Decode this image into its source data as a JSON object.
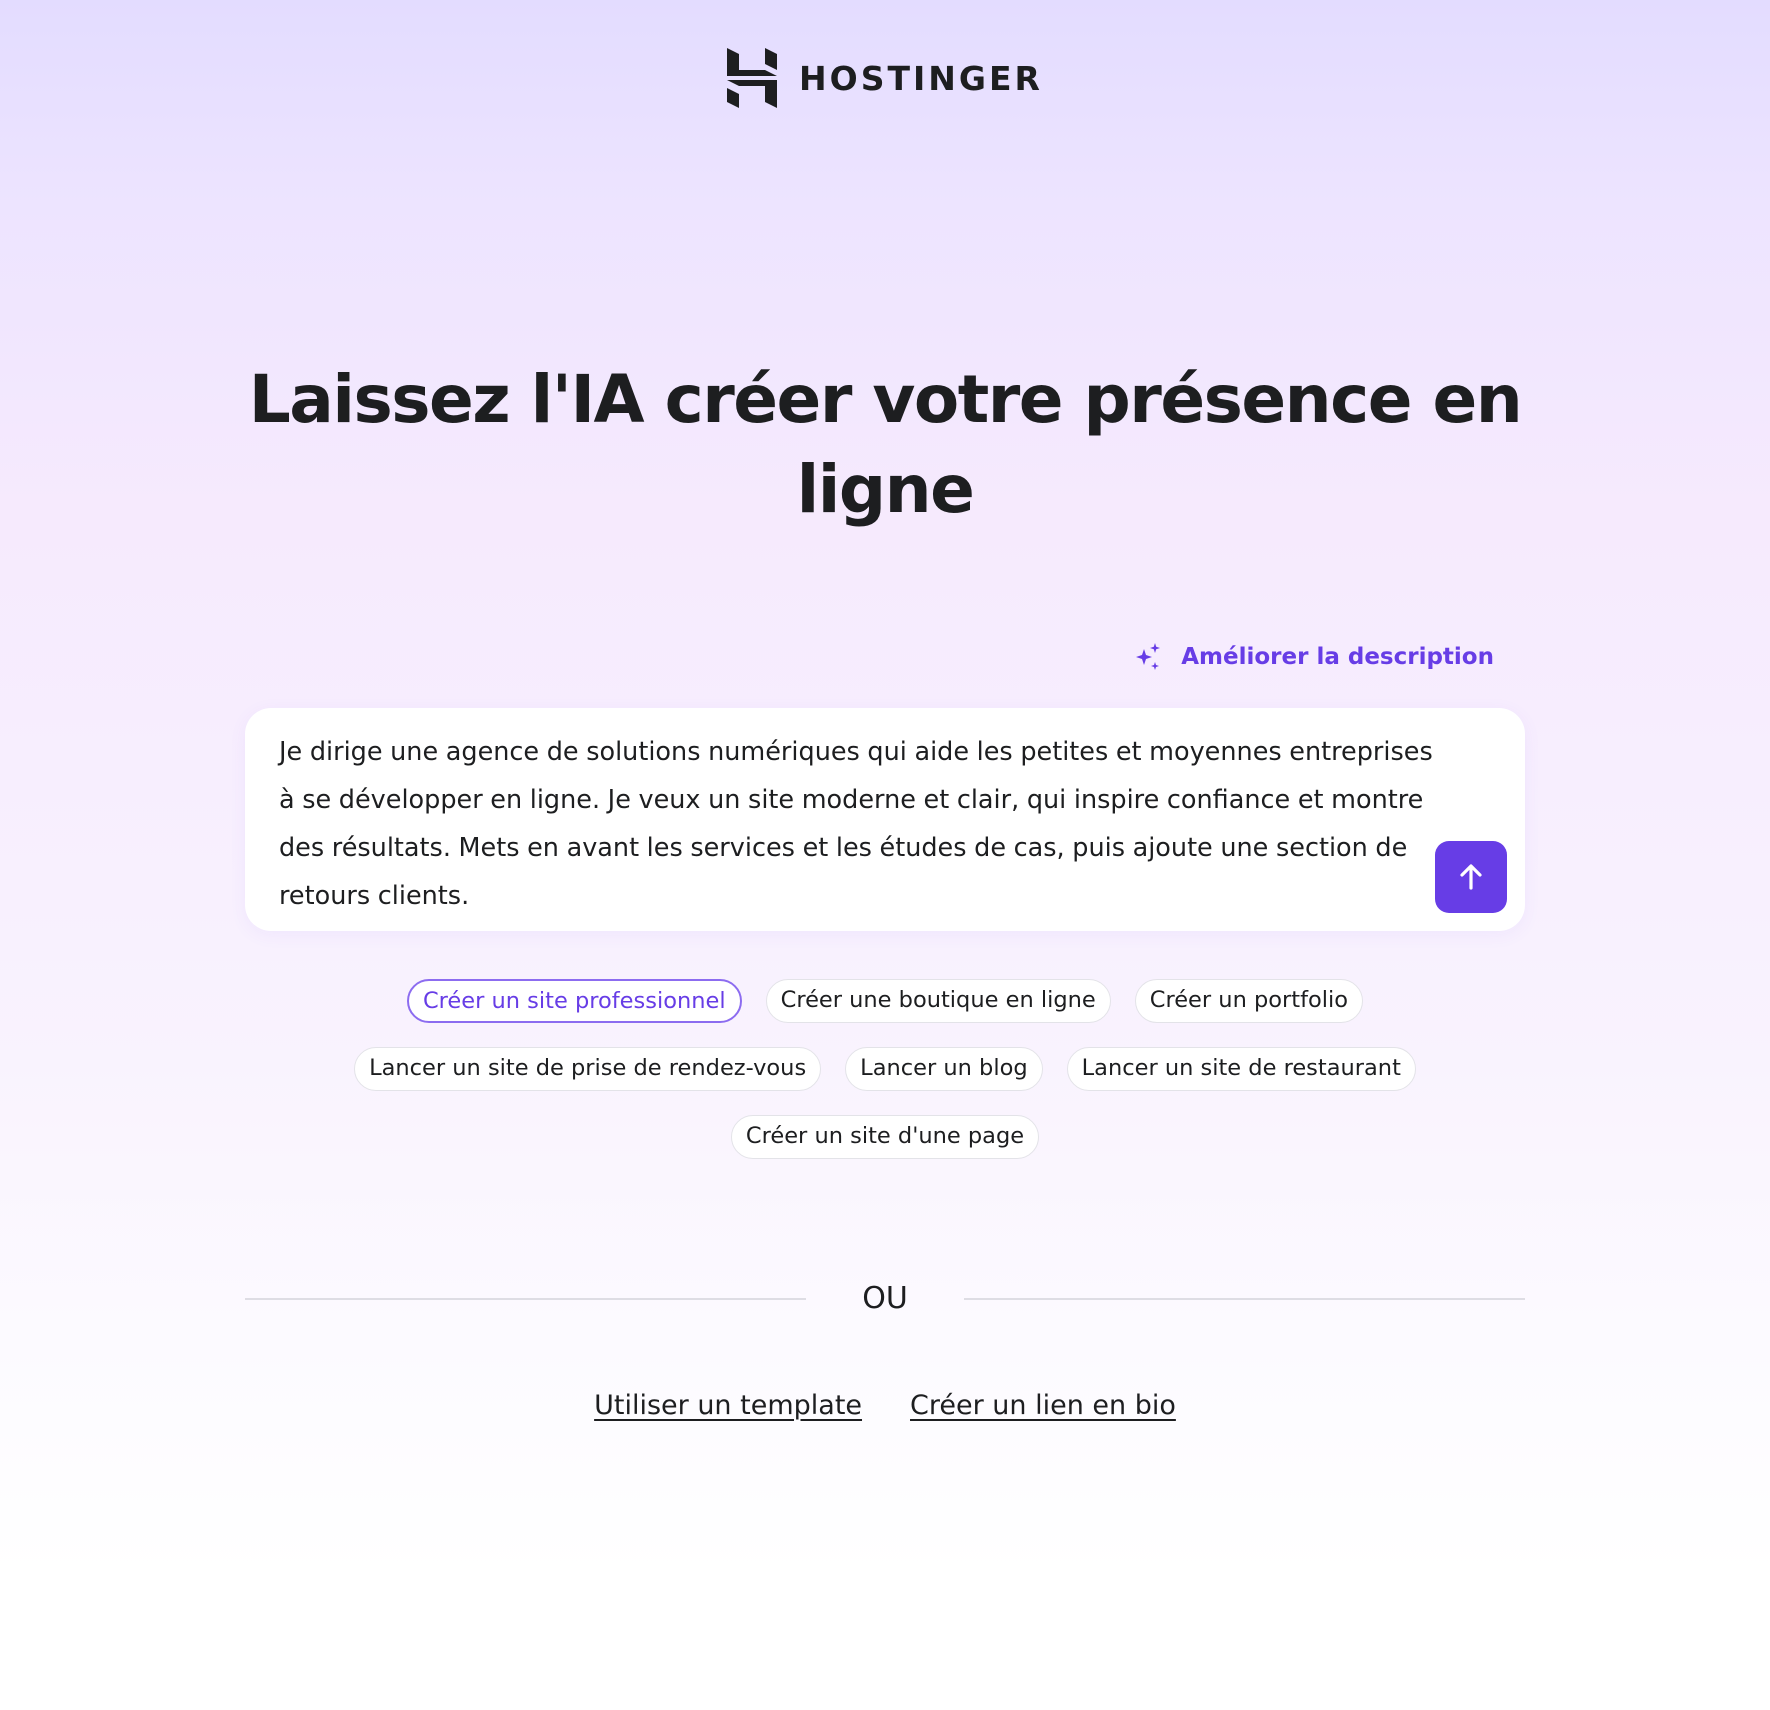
{
  "brand": {
    "name": "HOSTINGER",
    "logo_icon": "hostinger-h-logo"
  },
  "headline": "Laissez l'IA créer votre présence en ligne",
  "improve_description": {
    "label": "Améliorer la description",
    "icon": "sparkles-icon"
  },
  "prompt": {
    "value": "Je dirige une agence de solutions numériques qui aide les petites et moyennes entreprises à se développer en ligne. Je veux un site moderne et clair, qui inspire confiance et montre des résultats. Mets en avant les services et les études de cas, puis ajoute une section de retours clients.",
    "submit_icon": "arrow-up-icon"
  },
  "suggestions": [
    {
      "label": "Créer un site professionnel",
      "selected": true
    },
    {
      "label": "Créer une boutique en ligne",
      "selected": false
    },
    {
      "label": "Créer un portfolio",
      "selected": false
    },
    {
      "label": "Lancer un site de prise de rendez-vous",
      "selected": false
    },
    {
      "label": "Lancer un blog",
      "selected": false
    },
    {
      "label": "Lancer un site de restaurant",
      "selected": false
    },
    {
      "label": "Créer un site d'une page",
      "selected": false
    }
  ],
  "divider_label": "OU",
  "links": {
    "template": "Utiliser un template",
    "bio_link": "Créer un lien en bio"
  },
  "colors": {
    "accent": "#673de6",
    "text": "#1d1e20",
    "background_top": "#e3dcff",
    "background_bottom": "#ffffff"
  }
}
